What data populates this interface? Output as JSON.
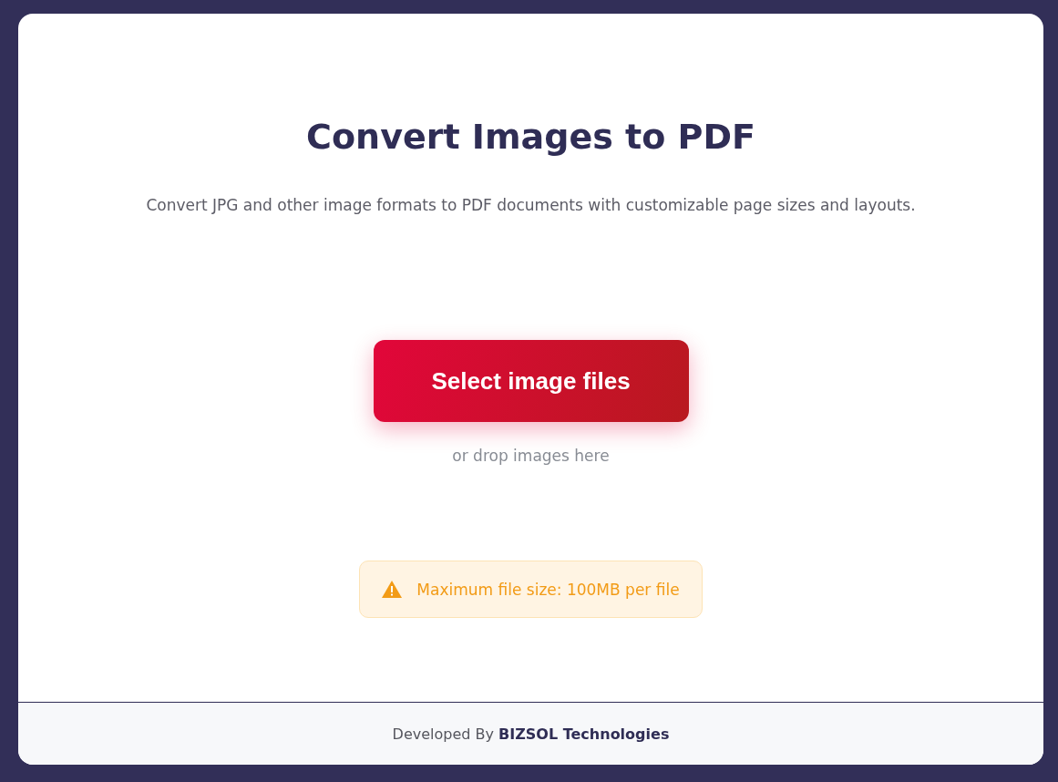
{
  "title": "Convert Images to PDF",
  "subtitle": "Convert JPG and other image formats to PDF documents with customizable page sizes and layouts.",
  "upload_button": "Select image files",
  "drop_hint": "or drop images here",
  "notice": {
    "kind": "warning",
    "text": "Maximum file size: 100MB per file"
  },
  "footer": "Developed By **BIZSOL Technologies**"
}
